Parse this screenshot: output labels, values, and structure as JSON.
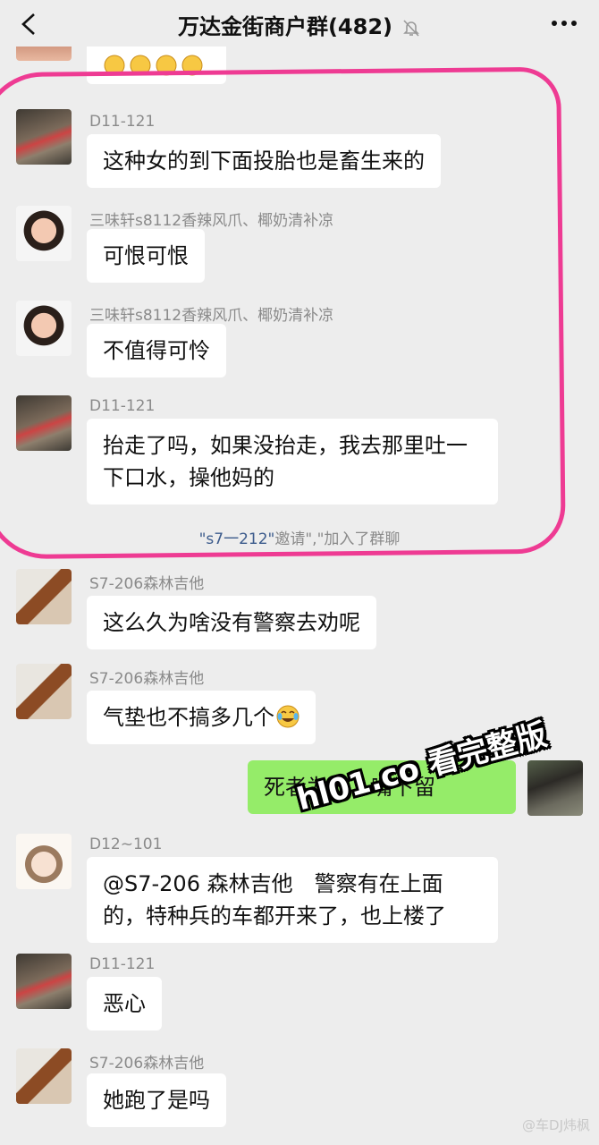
{
  "header": {
    "title": "万达金街商户群(482)",
    "icons": [
      "back-arrow-icon",
      "mute-bell-icon",
      "more-dots-icon"
    ]
  },
  "messages": [
    {
      "sender": "D11-121",
      "text": "这种女的到下面投胎也是畜生来的"
    },
    {
      "sender": "三味轩s8112香辣风爪、椰奶清补凉",
      "text": "可恨可恨"
    },
    {
      "sender": "三味轩s8112香辣风爪、椰奶清补凉",
      "text": "不值得可怜"
    },
    {
      "sender": "D11-121",
      "text": "抬走了吗，如果没抬走，我去那里吐一下口水，操他妈的"
    },
    {
      "sender": "S7-206森林吉他",
      "text": "这么久为啥没有警察去劝呢"
    },
    {
      "sender": "S7-206森林吉他",
      "text": "气垫也不搞多几个"
    },
    {
      "sender": "",
      "text": "死者为大，嘴下留"
    },
    {
      "sender": "D12~101",
      "text": "@S7-206 森林吉他　警察有在上面的，特种兵的车都开来了，也上楼了"
    },
    {
      "sender": "D11-121",
      "text": "恶心"
    },
    {
      "sender": "S7-206森林吉他",
      "text": "她跑了是吗"
    }
  ],
  "system_notice": {
    "quoted": "\"s7一212\"",
    "text": "邀请\",\"加入了群聊"
  },
  "watermark": "hl01.co 看完整版",
  "credit": "@车DJ炜枫",
  "colors": {
    "background": "#ededed",
    "bubble_in": "#ffffff",
    "bubble_out": "#95ec69",
    "highlight": "#ee3b93"
  }
}
